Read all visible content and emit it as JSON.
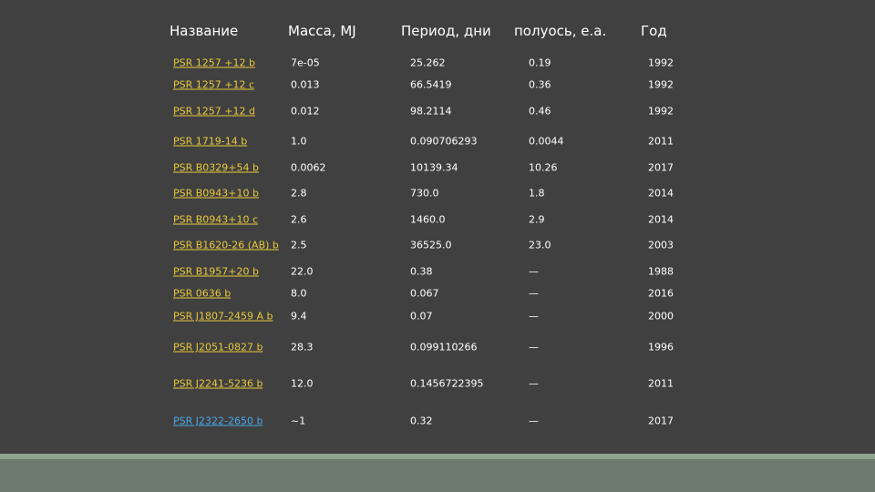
{
  "table": {
    "headers": [
      "Название",
      "Масса, MJ",
      "Период, дни",
      "полуось, е.а.",
      "Год"
    ],
    "rows": [
      {
        "name": "PSR 1257 +12 b",
        "mass": "7e-05",
        "period": "25.262",
        "axis": "0.19",
        "year": "1992",
        "link_color": "yellow"
      },
      {
        "name": "PSR 1257 +12 c",
        "mass": "0.013",
        "period": "66.5419",
        "axis": "0.36",
        "year": "1992",
        "link_color": "yellow"
      },
      {
        "name": "PSR 1257 +12 d",
        "mass": "0.012",
        "period": "98.2114",
        "axis": "0.46",
        "year": "1992",
        "link_color": "yellow"
      },
      {
        "name": "PSR 1719-14 b",
        "mass": "1.0",
        "period": "0.090706293",
        "axis": "0.0044",
        "year": "2011",
        "link_color": "yellow"
      },
      {
        "name": "PSR B0329+54 b",
        "mass": "0.0062",
        "period": "10139.34",
        "axis": "10.26",
        "year": "2017",
        "link_color": "yellow"
      },
      {
        "name": "PSR B0943+10 b",
        "mass": "2.8",
        "period": "730.0",
        "axis": "1.8",
        "year": "2014",
        "link_color": "yellow"
      },
      {
        "name": "PSR B0943+10 c",
        "mass": "2.6",
        "period": "1460.0",
        "axis": "2.9",
        "year": "2014",
        "link_color": "yellow"
      },
      {
        "name": "PSR B1620-26 (AB) b",
        "mass": "2.5",
        "period": "36525.0",
        "axis": "23.0",
        "year": "2003",
        "link_color": "yellow"
      },
      {
        "name": "PSR B1957+20 b",
        "mass": "22.0",
        "period": "0.38",
        "axis": "—",
        "year": "1988",
        "link_color": "yellow"
      },
      {
        "name": "PSR 0636 b",
        "mass": "8.0",
        "period": "0.067",
        "axis": "—",
        "year": "2016",
        "link_color": "yellow"
      },
      {
        "name": "PSR J1807-2459 A b",
        "mass": "9.4",
        "period": "0.07",
        "axis": "—",
        "year": "2000",
        "link_color": "yellow"
      },
      {
        "name": "PSR J2051-0827 b",
        "mass": "28.3",
        "period": "0.099110266",
        "axis": "—",
        "year": "1996",
        "link_color": "yellow"
      },
      {
        "name": "PSR J2241-5236 b",
        "mass": "12.0",
        "period": "0.1456722395",
        "axis": "—",
        "year": "2011",
        "link_color": "yellow"
      },
      {
        "name": "PSR J2322-2650 b",
        "mass": "~1",
        "period": "0.32",
        "axis": "—",
        "year": "2017",
        "link_color": "blue"
      }
    ]
  },
  "colors": {
    "slide_bg": "#404040",
    "footer_bg": "#6b7a6d",
    "link_yellow": "#e8c83a",
    "link_blue": "#4aa8e8",
    "text": "#ffffff"
  }
}
